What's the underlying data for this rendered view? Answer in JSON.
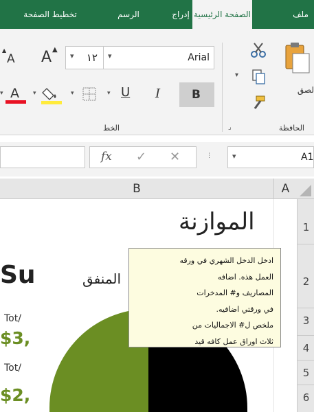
{
  "tabs": [
    {
      "label": "ملف",
      "active": false
    },
    {
      "label": "الصفحة الرئيسية",
      "active": true
    },
    {
      "label": "إدراج",
      "active": false
    },
    {
      "label": "الرسم",
      "active": false
    },
    {
      "label": "تخطيط الصفحة",
      "active": false
    }
  ],
  "font": {
    "name": "Arial",
    "size": "١٢",
    "group_label": "الخط",
    "grow_label": "A",
    "shrink_label": "A",
    "bold_label": "B",
    "italic_label": "I",
    "underline_label": "U",
    "font_color_label": "A"
  },
  "clipboard": {
    "paste_label": "لصق",
    "group_label": "الحافظة"
  },
  "formula_bar": {
    "name_box": "A1",
    "fx_label": "fx"
  },
  "columns": [
    "A",
    "B"
  ],
  "rows": [
    "1",
    "2",
    "3",
    "4",
    "5",
    "6"
  ],
  "sheet": {
    "title": "الموازنة",
    "spent_label": "المنفق",
    "partial_texts": [
      "Su",
      "Tot/",
      "$3,",
      "Tot/",
      "$2,"
    ]
  },
  "tooltip": {
    "lines": [
      "ادخل الدخل الشهري في ورقه",
      "العمل هذه. اضافه",
      "المصاريف و# المدخرات",
      "في ورقتي اضافيه.",
      "ملخص ل# الاجماليات من",
      "ثلاث اوراق عمل كافه قيد"
    ]
  },
  "colors": {
    "ribbon_green": "#217346",
    "accent_green": "#6b8e23",
    "font_color_red": "#e81123",
    "highlight_yellow": "#ffeb3b"
  }
}
